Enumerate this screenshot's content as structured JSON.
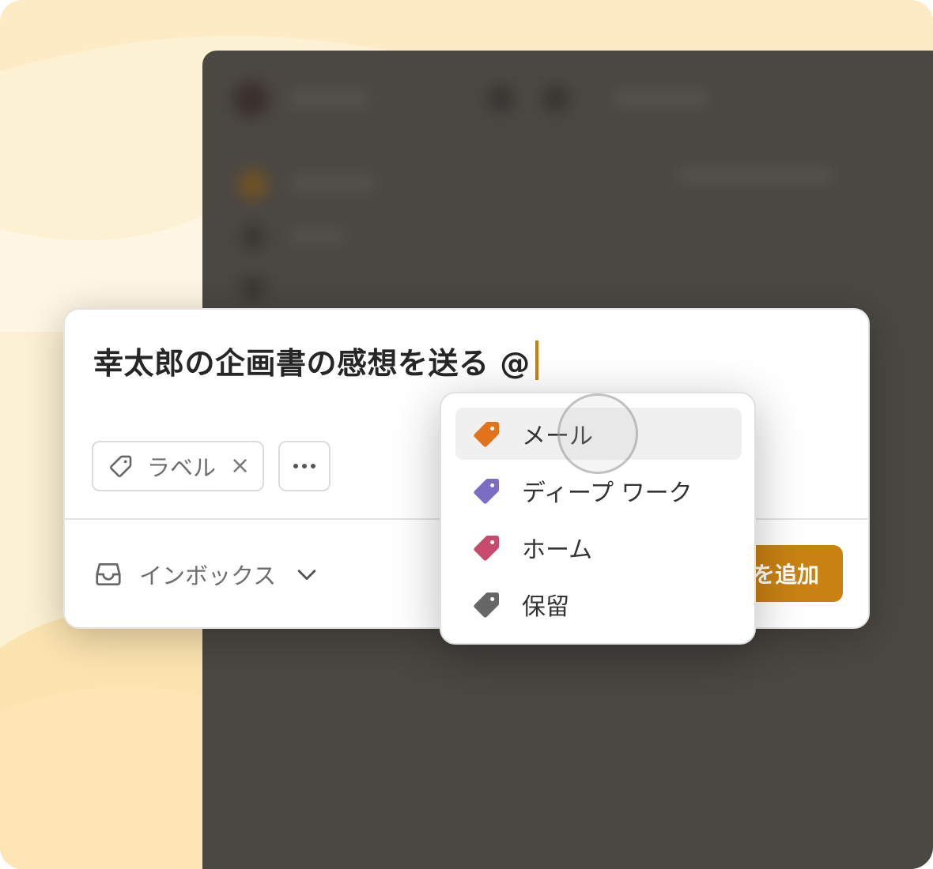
{
  "quick_add": {
    "task_title": "幸太郎の企画書の感想を送る @",
    "chip_label": "ラベル",
    "chip_remove": "×",
    "project": "インボックス",
    "add_button": "を追加"
  },
  "label_menu": {
    "items": [
      {
        "label": "メール",
        "color": "#e2731a",
        "active": true
      },
      {
        "label": "ディープ ワーク",
        "color": "#7b6dc3",
        "active": false
      },
      {
        "label": "ホーム",
        "color": "#c84a6e",
        "active": false
      },
      {
        "label": "保留",
        "color": "#666666",
        "active": false
      }
    ]
  },
  "colors": {
    "accent": "#c98212",
    "caret": "#c87f0a",
    "backdrop": "#fdf0d2",
    "app_window": "#4b4743"
  },
  "icons": [
    "tag-outline-icon",
    "close-icon",
    "more-icon",
    "inbox-tray-icon",
    "chevron-down-icon",
    "tag-filled-icon"
  ]
}
